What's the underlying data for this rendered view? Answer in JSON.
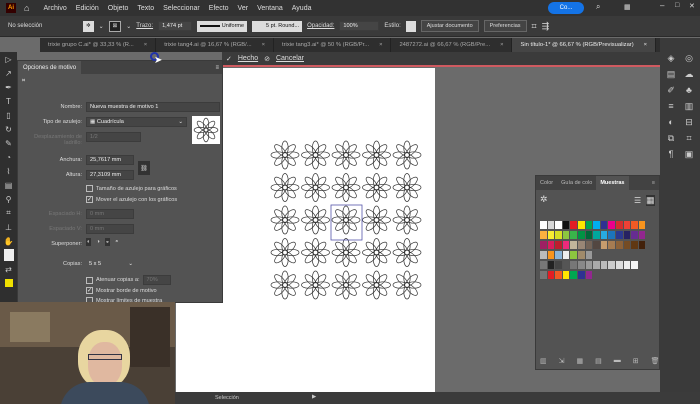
{
  "menu": {
    "logo": "Ai",
    "items": [
      "Archivo",
      "Edición",
      "Objeto",
      "Texto",
      "Seleccionar",
      "Efecto",
      "Ver",
      "Ventana",
      "Ayuda"
    ],
    "user": "Co..."
  },
  "control": {
    "selection": "No selección",
    "stroke_label": "Trazo:",
    "stroke_value": "1,474 pt",
    "profile": "Uniforme",
    "brush": "5 pt. Round...",
    "opacity_label": "Opacidad:",
    "opacity": "100%",
    "style_label": "Estilo:",
    "fit_doc": "Ajustar documento",
    "prefs": "Preferencias"
  },
  "tabs": [
    {
      "label": "trixie grupo C.ai* @ 33,33 % (R..."
    },
    {
      "label": "trixie tang4.ai @ 16,67 % (RGB/..."
    },
    {
      "label": "trixie tang3.ai* @ 50 % (RGB/Pr..."
    },
    {
      "label": "2487272.ai @ 66,67 % (RGB/Pre..."
    },
    {
      "label": "Sin título-1* @ 66,67 % (RGB/Previsualizar)"
    }
  ],
  "editbar": {
    "done": "Hecho",
    "cancel": "Cancelar"
  },
  "pattern_panel": {
    "title": "Opciones de motivo",
    "name_label": "Nombre:",
    "name_value": "Nueva muestra de motivo 1",
    "tile_type_label": "Tipo de azulejo:",
    "tile_type_value": "Cuadrícula",
    "brick_offset_label": "Desplazamiento de ladrillo:",
    "brick_offset_value": "1/2",
    "width_label": "Anchura:",
    "width_value": "25,7617 mm",
    "height_label": "Altura:",
    "height_value": "27,3109 mm",
    "size_tile_label": "Tamaño de azulejo para gráficos",
    "size_tile_checked": false,
    "move_tile_label": "Mover el azulejo con los gráficos",
    "move_tile_checked": true,
    "hspacing_label": "Espaciado H:",
    "hspacing_value": "0 mm",
    "vspacing_label": "Espaciado V:",
    "vspacing_value": "0 mm",
    "overlap_label": "Superponer:",
    "copies_label": "Copias:",
    "copies_value": "5 x 5",
    "dim_copies_label": "Atenuar copias a:",
    "dim_copies_value": "70%",
    "dim_copies_checked": false,
    "show_edge_label": "Mostrar borde de motivo",
    "show_edge_checked": true,
    "show_bounds_label": "Mostrar límites de muestra",
    "show_bounds_checked": false
  },
  "swatches": {
    "tabs": [
      "Color",
      "Guía de colo",
      "Muestras"
    ],
    "active_tab": "Muestras",
    "rows": [
      [
        "#ffffff",
        "#d8d8d8",
        "#ffffff",
        "#111111",
        "#e31e24",
        "#ffe600",
        "#00a651",
        "#00aeef",
        "#2e3192",
        "#ec008c",
        "#d62e2e",
        "#ef4136",
        "#f15a24",
        "#f7941d"
      ],
      [
        "#fbb040",
        "#f9ed32",
        "#d7df23",
        "#8dc63f",
        "#39b54a",
        "#009444",
        "#006838",
        "#00a79d",
        "#27aae1",
        "#1c75bc",
        "#2b3990",
        "#262262",
        "#662d91",
        "#92278f"
      ],
      [
        "#9e1f63",
        "#da1c5c",
        "#be1e2d",
        "#ee2a7b",
        "#c2b59b",
        "#998675",
        "#736357",
        "#534741",
        "#c69c6d",
        "#a67c52",
        "#8c6239",
        "#754c24",
        "#603813",
        "#42210b"
      ],
      [
        "#bbbbbb",
        "#f7941d",
        "#8ab4d8",
        "#eeeeee",
        "#8dc63f",
        "#a08a6a",
        "#999999"
      ],
      [
        "#777777",
        "#222222",
        "#444444",
        "#555555",
        "#777777",
        "#888888",
        "#999999",
        "#aaaaaa",
        "#bbbbbb",
        "#cccccc",
        "#dddddd",
        "#eeeeee",
        "#f5f5f5"
      ],
      [
        "#777777",
        "#e31e24",
        "#f15a24",
        "#ffe600",
        "#00a651",
        "#2e3192",
        "#92278f"
      ]
    ]
  },
  "status": {
    "tool": "Selección"
  }
}
